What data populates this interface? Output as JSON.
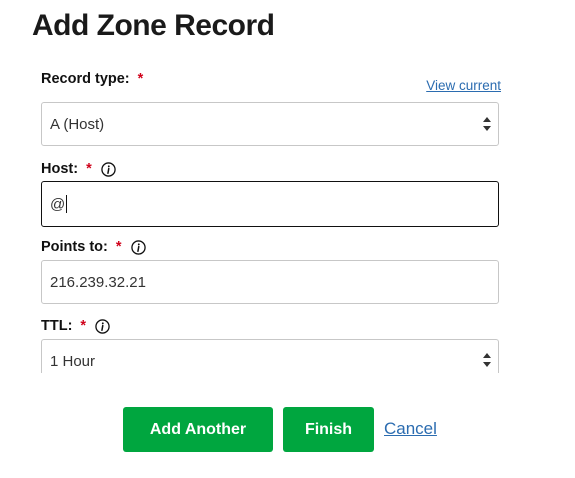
{
  "page": {
    "title": "Add Zone Record"
  },
  "form": {
    "required_marker": "*",
    "view_current_link": "View current",
    "record_type": {
      "label": "Record type:",
      "value": "A (Host)"
    },
    "host": {
      "label": "Host:",
      "value": "@"
    },
    "points_to": {
      "label": "Points to:",
      "value": "216.239.32.21"
    },
    "ttl": {
      "label": "TTL:",
      "value": "1 Hour"
    }
  },
  "actions": {
    "add_another": "Add Another",
    "finish": "Finish",
    "cancel": "Cancel"
  },
  "colors": {
    "primary_button": "#00a63f",
    "link": "#2b6cb0",
    "required": "#d0021b"
  }
}
